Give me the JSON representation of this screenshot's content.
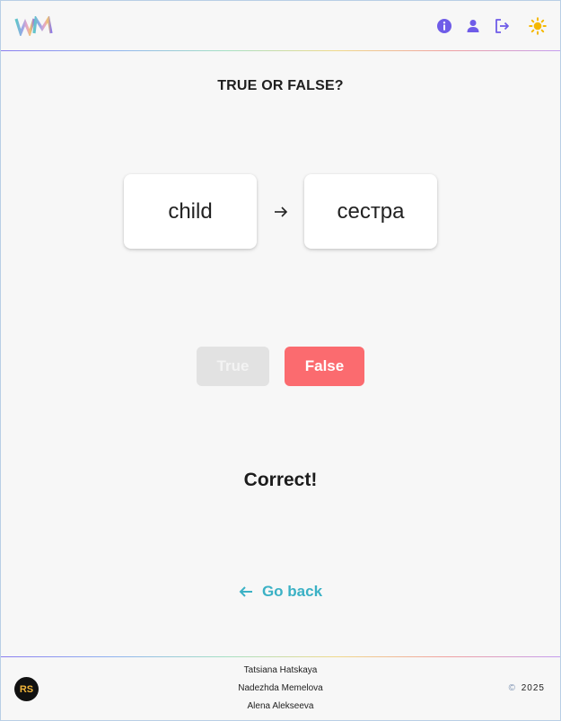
{
  "header": {
    "logo_text": "WM",
    "icons": [
      "info-icon",
      "user-icon",
      "logout-icon",
      "sun-icon"
    ],
    "colors": {
      "icon": "#6f5ce8",
      "sun": "#f5b800"
    }
  },
  "main": {
    "title": "TRUE OR FALSE?",
    "word": "child",
    "translation": "сестра",
    "buttons": {
      "true_label": "True",
      "false_label": "False"
    },
    "result": "Correct!",
    "go_back": "Go back",
    "colors": {
      "false_button": "#fb6b6f",
      "true_button_disabled": "#e2e2e2",
      "go_back": "#3bb1c5"
    }
  },
  "footer": {
    "logo_text": "RS",
    "authors": [
      "Tatsiana Hatskaya",
      "Nadezhda Memelova",
      "Alena Alekseeva"
    ],
    "copyright_symbol": "©",
    "year": "2025"
  }
}
